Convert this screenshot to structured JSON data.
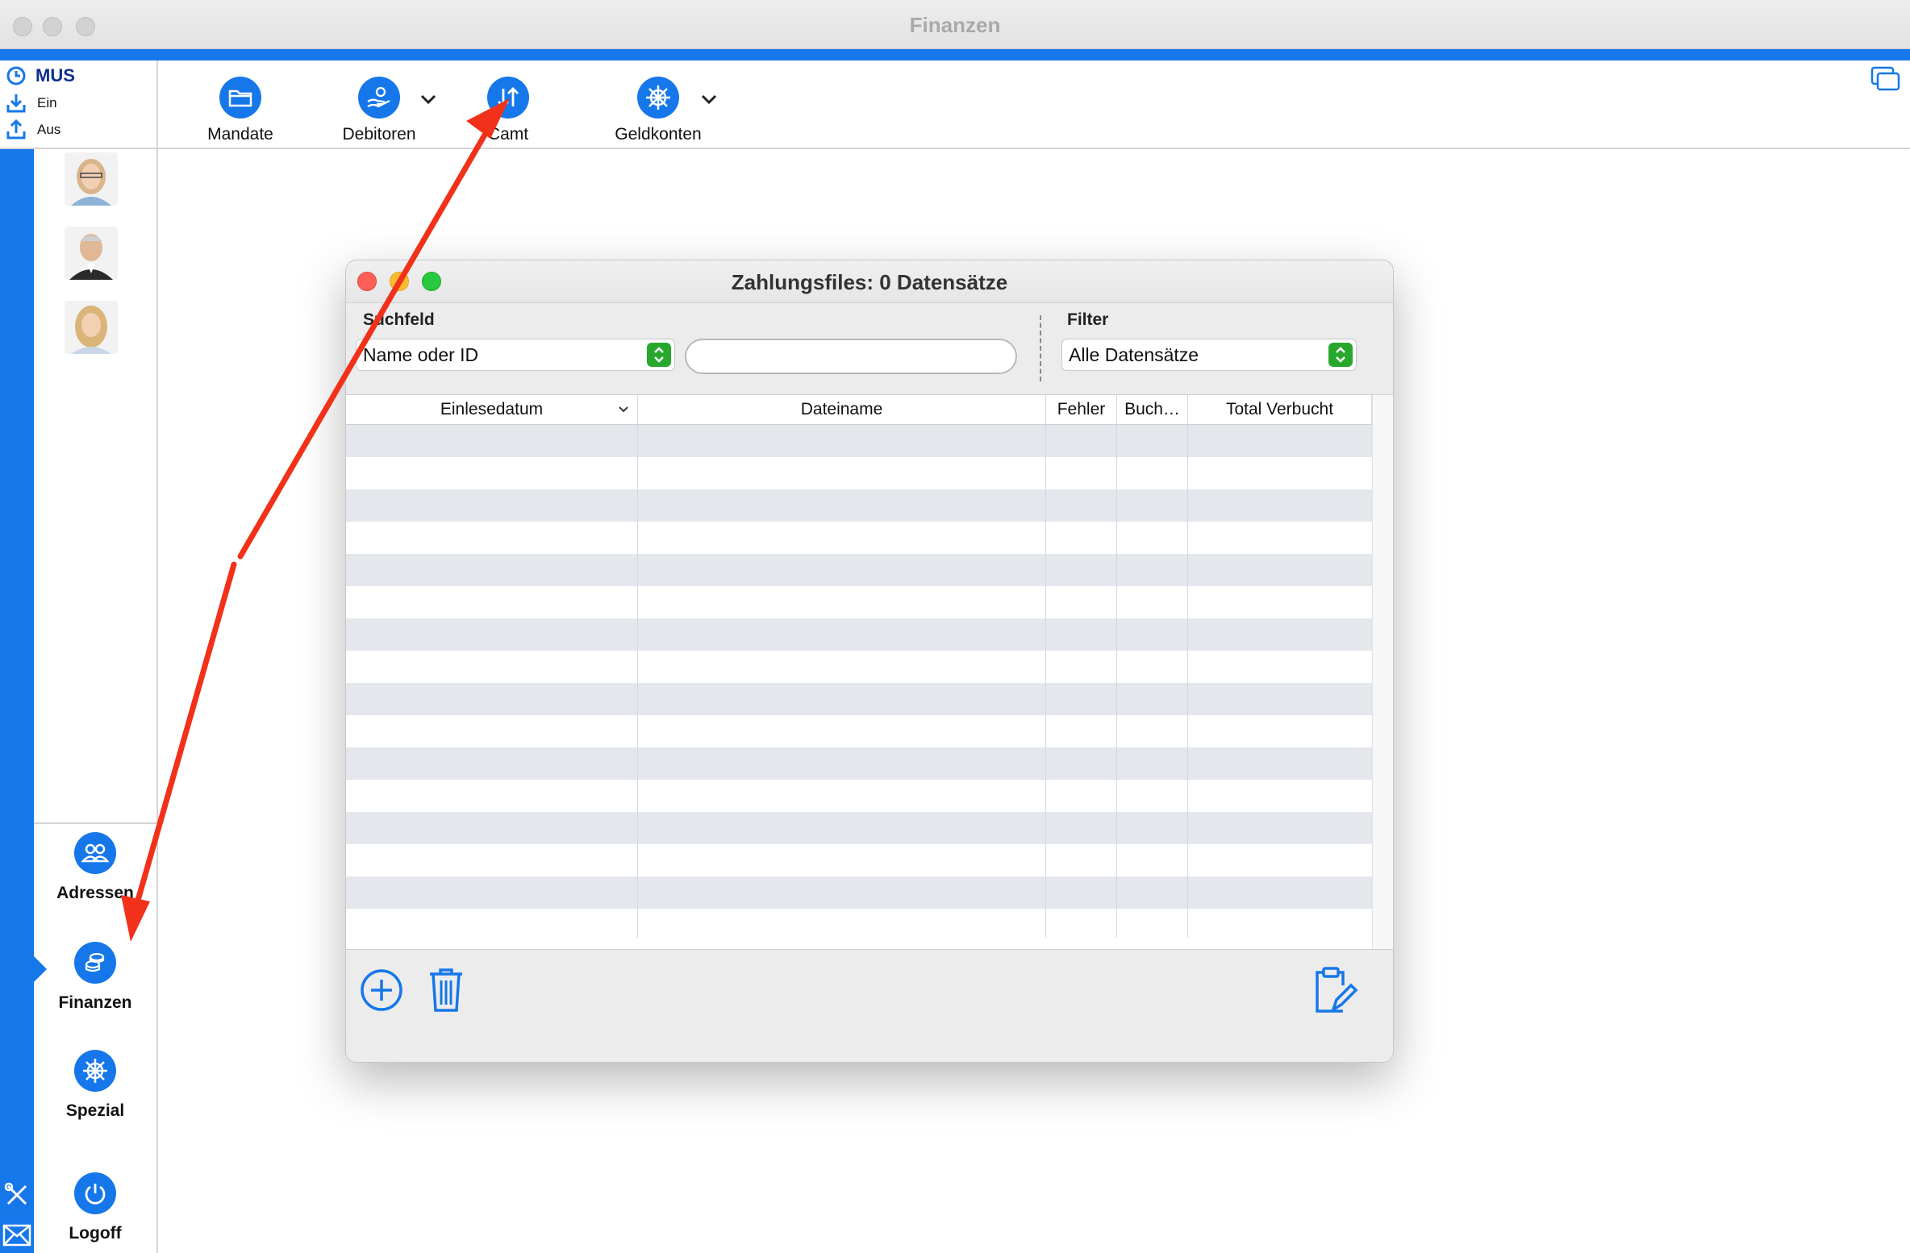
{
  "window": {
    "title": "Finanzen"
  },
  "user_panel": {
    "user": "MUS",
    "in_label": "Ein",
    "out_label": "Aus"
  },
  "toolbar": {
    "items": [
      {
        "label": "Mandate",
        "icon": "folder-icon"
      },
      {
        "label": "Debitoren",
        "icon": "hand-coin-icon"
      },
      {
        "label": "Camt",
        "icon": "arrows-up-down-icon"
      },
      {
        "label": "Geldkonten",
        "icon": "helm-icon"
      }
    ]
  },
  "nav": {
    "items": [
      {
        "label": "Adressen",
        "icon": "people-icon"
      },
      {
        "label": "Finanzen",
        "icon": "coins-icon",
        "selected": true
      },
      {
        "label": "Spezial",
        "icon": "helm-icon"
      },
      {
        "label": "Logoff",
        "icon": "power-icon"
      }
    ]
  },
  "dialog": {
    "title": "Zahlungsfiles: 0 Datensätze",
    "search_label": "Suchfeld",
    "search_field_value": "Name oder ID",
    "search_text_value": "",
    "filter_label": "Filter",
    "filter_value": "Alle Datensätze",
    "columns": [
      "Einlesedatum",
      "Dateiname",
      "Fehler",
      "Buch…",
      "Total Verbucht"
    ],
    "rows": []
  },
  "colors": {
    "accent": "#1677ea",
    "annotation": "#f2311b",
    "popup_green": "#27a82d"
  }
}
